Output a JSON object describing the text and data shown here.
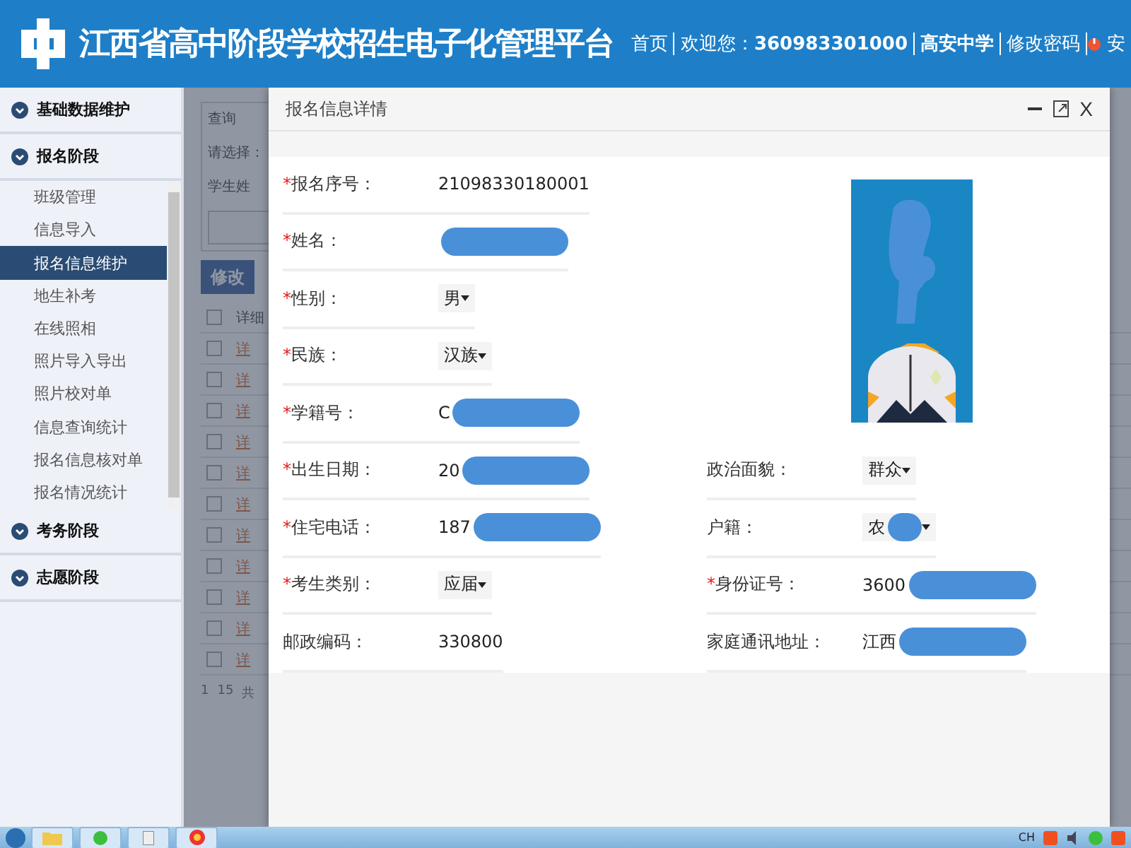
{
  "header": {
    "title": "江西省高中阶段学校招生电子化管理平台",
    "nav": [
      {
        "text": "首页",
        "kind": "link"
      },
      {
        "text": "欢迎您：**360983301000**",
        "kind": "link"
      },
      {
        "text": "高安中学",
        "kind": "school"
      },
      {
        "text": "修改密码",
        "kind": "link"
      },
      {
        "text": "安",
        "kind": "power"
      }
    ]
  },
  "sidebar": {
    "groups": [
      {
        "label": "基础数据维护"
      },
      {
        "label": "报名阶段",
        "children": [
          {
            "label": "班级管理",
            "selected": false
          },
          {
            "label": "信息导入",
            "selected": false
          },
          {
            "label": "报名信息维护",
            "selected": true
          },
          {
            "label": "地生补考",
            "selected": false
          },
          {
            "label": "在线照相",
            "selected": false
          },
          {
            "label": "照片导入导出",
            "selected": false
          },
          {
            "label": "照片校对单",
            "selected": false
          },
          {
            "label": "信息查询统计",
            "selected": false
          },
          {
            "label": "报名信息核对单",
            "selected": false
          },
          {
            "label": "报名情况统计",
            "selected": false
          }
        ]
      },
      {
        "label": "考务阶段"
      },
      {
        "label": "志愿阶段"
      }
    ]
  },
  "page": {
    "query_legend": "查询",
    "select_label": "请选择：",
    "name_label": "学生姓",
    "edit_button": "修改",
    "detail_header": "详细",
    "header_checked": false,
    "rows": [
      {
        "link": "详",
        "checked": false
      },
      {
        "link": "详",
        "checked": false
      },
      {
        "link": "详",
        "checked": false
      },
      {
        "link": "详",
        "checked": false
      },
      {
        "link": "详",
        "checked": false
      },
      {
        "link": "详",
        "checked": false
      },
      {
        "link": "详",
        "checked": false
      },
      {
        "link": "详",
        "checked": false
      },
      {
        "link": "详",
        "checked": false
      },
      {
        "link": "详",
        "checked": false
      },
      {
        "link": "详",
        "checked": false
      }
    ],
    "pager": [
      "1",
      "15",
      "共"
    ]
  },
  "dialog": {
    "title": "报名信息详情",
    "close": "X",
    "left_fields": [
      {
        "star": "*",
        "label": "报名序号：",
        "value": "21098330180001",
        "kind": "text"
      },
      {
        "star": "*",
        "label": "姓名：",
        "kind": "text",
        "redacted": true
      },
      {
        "star": "*",
        "label": "性别：",
        "value": "男",
        "kind": "select"
      },
      {
        "star": "*",
        "label": "民族：",
        "value": "汉族",
        "kind": "select"
      },
      {
        "star": "*",
        "label": "学籍号：",
        "value": "C",
        "kind": "text",
        "redacted": true
      },
      {
        "star": "*",
        "label": "出生日期：",
        "value": "20",
        "kind": "text",
        "redacted": true
      },
      {
        "star": "*",
        "label": "住宅电话：",
        "value": "187",
        "kind": "text",
        "redacted": true
      },
      {
        "star": "*",
        "label": "考生类别：",
        "value": "应届",
        "kind": "select"
      },
      {
        "label": "邮政编码：",
        "value": "330800",
        "kind": "text"
      }
    ],
    "right_fields": [
      {
        "label": "政治面貌：",
        "value": "群众",
        "kind": "select"
      },
      {
        "label": "户籍：",
        "value": "农",
        "kind": "select",
        "redacted": true
      },
      {
        "star": "*",
        "label": "身份证号：",
        "value": "3600",
        "kind": "text",
        "redacted": true
      },
      {
        "label": "家庭通讯地址：",
        "value": "江西",
        "kind": "text",
        "redacted": true
      }
    ]
  },
  "taskbar": {
    "language": "CH"
  }
}
